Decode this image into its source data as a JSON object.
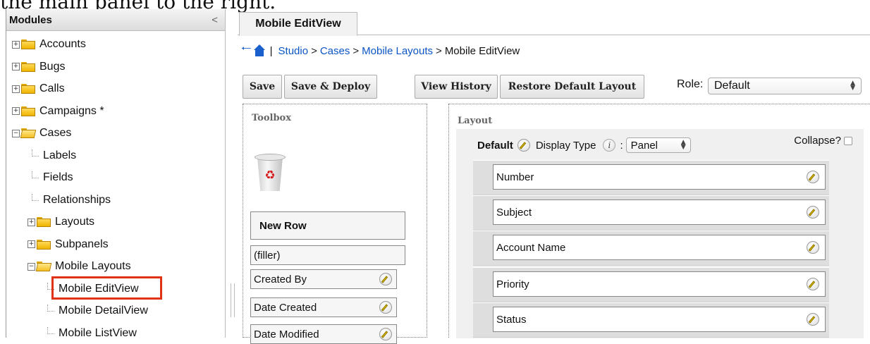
{
  "caption": "the main panel to the right.",
  "sidebar": {
    "title": "Modules",
    "collapse_glyph": "<",
    "items": [
      {
        "label": "Accounts",
        "type": "folder",
        "expander": "+"
      },
      {
        "label": "Bugs",
        "type": "folder",
        "expander": "+"
      },
      {
        "label": "Calls",
        "type": "folder",
        "expander": "+"
      },
      {
        "label": "Campaigns *",
        "type": "folder",
        "expander": "+"
      },
      {
        "label": "Cases",
        "type": "folder-open",
        "expander": "−"
      },
      {
        "label": "Labels",
        "type": "leaf"
      },
      {
        "label": "Fields",
        "type": "leaf"
      },
      {
        "label": "Relationships",
        "type": "leaf"
      },
      {
        "label": "Layouts",
        "type": "folder",
        "expander": "+"
      },
      {
        "label": "Subpanels",
        "type": "folder",
        "expander": "+"
      },
      {
        "label": "Mobile Layouts",
        "type": "folder-open",
        "expander": "−"
      },
      {
        "label": "Mobile EditView",
        "type": "leaf",
        "selected": true
      },
      {
        "label": "Mobile DetailView",
        "type": "leaf"
      },
      {
        "label": "Mobile ListView",
        "type": "leaf"
      }
    ]
  },
  "tab": {
    "label": "Mobile EditView"
  },
  "breadcrumb": {
    "sep": "|",
    "studio": "Studio",
    "cases": "Cases",
    "mobile_layouts": "Mobile Layouts",
    "current": "Mobile EditView",
    "arrow": ">"
  },
  "toolbar": {
    "save": "Save",
    "save_deploy": "Save & Deploy",
    "view_history": "View History",
    "restore": "Restore Default Layout",
    "role_label": "Role:",
    "role_value": "Default"
  },
  "toolbox": {
    "title": "Toolbox",
    "new_row": "New Row",
    "fields": [
      "(filler)",
      "Created By",
      "Date Created",
      "Date Modified"
    ]
  },
  "layout": {
    "title": "Layout",
    "panel_name": "Default",
    "display_type_label": "Display Type",
    "colon": ":",
    "display_type_value": "Panel",
    "collapse_label": "Collapse?",
    "collapse_checked": false,
    "fields": [
      "Number",
      "Subject",
      "Account Name",
      "Priority",
      "Status"
    ]
  },
  "colors": {
    "link": "#0b55c4",
    "highlight": "#e03214"
  }
}
